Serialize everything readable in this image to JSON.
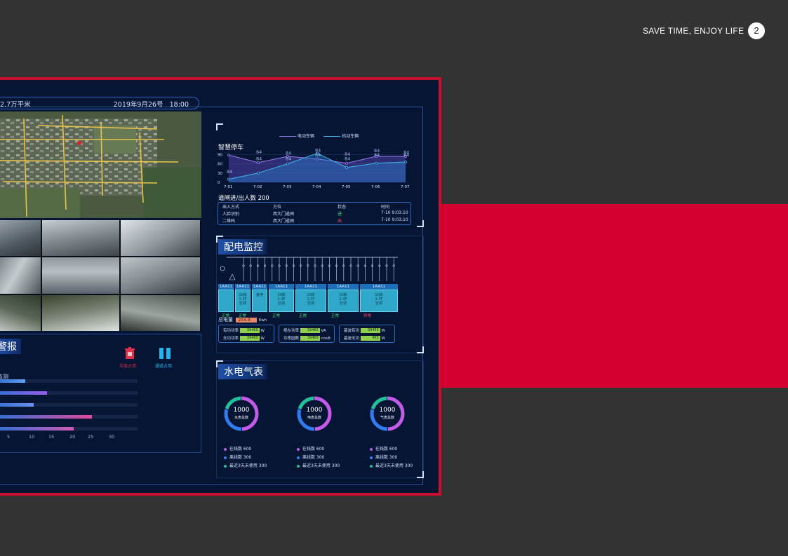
{
  "header": {
    "tagline": "SAVE TIME, ENJOY LIFE",
    "page_number": "2"
  },
  "colors": {
    "brand_red": "#d4002f",
    "background": "#333333",
    "dashboard_bg": "#071535"
  },
  "dashboard": {
    "area_text": "2.7万平米",
    "date_text": "2019年9月26号",
    "time_text": "18:00",
    "alarm": {
      "title": "警报",
      "icons": [
        {
          "label": "垃圾占用",
          "icon": "trash-icon",
          "color": "#e0304a"
        },
        {
          "label": "通道占用",
          "icon": "passage-icon",
          "color": "#23b4f0"
        }
      ],
      "monitor_label": "监测",
      "bar_values": [
        5,
        10,
        7,
        20,
        16
      ],
      "x_ticks": [
        "5",
        "10",
        "15",
        "20",
        "25",
        "30"
      ]
    },
    "parking": {
      "title": "智慧停车",
      "legend": [
        "电动车辆",
        "机动车辆"
      ],
      "x": [
        "7-01",
        "7-02",
        "7-03",
        "7-04",
        "7-05",
        "7-06",
        "7-07"
      ],
      "y_ticks": [
        "90",
        "60",
        "30",
        "0"
      ],
      "chart_data": {
        "type": "area",
        "x": [
          "7-01",
          "7-02",
          "7-03",
          "7-04",
          "7-05",
          "7-06",
          "7-07"
        ],
        "ylim": [
          0,
          100
        ],
        "y_ticks": [
          0,
          30,
          60,
          90
        ],
        "series": [
          {
            "name": "电动车辆",
            "values": [
              88,
              64,
              84,
              76,
              62,
              84,
              84
            ]
          },
          {
            "name": "机动车辆",
            "values": [
              10,
              30,
              60,
              94,
              48,
              62,
              66
            ]
          }
        ],
        "data_labels": [
          "84",
          "84",
          "84",
          "84",
          "84",
          "84",
          "84",
          "84",
          "84",
          "84",
          "84",
          "84",
          "84"
        ]
      },
      "gate_label": "道闸进/出人数",
      "gate_count": "200",
      "table_headers": [
        "出入方式",
        "方位",
        "状态",
        "时间"
      ],
      "table_rows": [
        [
          "人脸识别",
          "西大门道闸",
          "进",
          "7-10  9:03:10"
        ],
        [
          "二维码",
          "西大门道闸",
          "出",
          "7-10  9:03:10"
        ]
      ]
    },
    "power": {
      "title": "配电监控",
      "cabinets": [
        {
          "head": "1AA11",
          "body": "",
          "status": "正常"
        },
        {
          "head": "1AA11",
          "body": "10栋\n1-3F\n空调",
          "status": "正常"
        },
        {
          "head": "1AA11",
          "body": "备用",
          "status": ""
        },
        {
          "head": "1AA11",
          "body": "10栋\n1-3F\n空调",
          "status": "正常"
        },
        {
          "head": "1AA11",
          "body": "10栋\n1-3F\n空调",
          "status": "正常"
        },
        {
          "head": "1AA11",
          "body": "10栋\n1-3F\n空调",
          "status": "正常"
        },
        {
          "head": "1AA11",
          "body": "10栋\n1-3F\n空调",
          "status": "异常"
        }
      ],
      "total_label": "总电量",
      "total_value": "254.9",
      "total_unit": "Kwh",
      "meters": [
        [
          {
            "label": "有功功率",
            "value": "39465",
            "unit": "W"
          },
          {
            "label": "无功功率",
            "value": "39465",
            "unit": "W"
          }
        ],
        [
          {
            "label": "视在功率",
            "value": "39465",
            "unit": "VA"
          },
          {
            "label": "功率因数",
            "value": "39465",
            "unit": "cosΦ"
          }
        ],
        [
          {
            "label": "基波有功",
            "value": "39465",
            "unit": "W"
          },
          {
            "label": "基波无功",
            "value": "465",
            "unit": "W"
          }
        ]
      ]
    },
    "meters_panel": {
      "title": "水电气表",
      "gauges": [
        {
          "value": "1000",
          "label": "水表总数"
        },
        {
          "value": "1000",
          "label": "电表总数"
        },
        {
          "value": "1000",
          "label": "气表总数"
        }
      ],
      "legend": [
        {
          "label": "在线数",
          "value": "600",
          "color": "#c25be8"
        },
        {
          "label": "离线数",
          "value": "300",
          "color": "#2f7df0"
        },
        {
          "label": "最近3天未使用",
          "value": "300",
          "color": "#1fc29a"
        }
      ]
    }
  }
}
